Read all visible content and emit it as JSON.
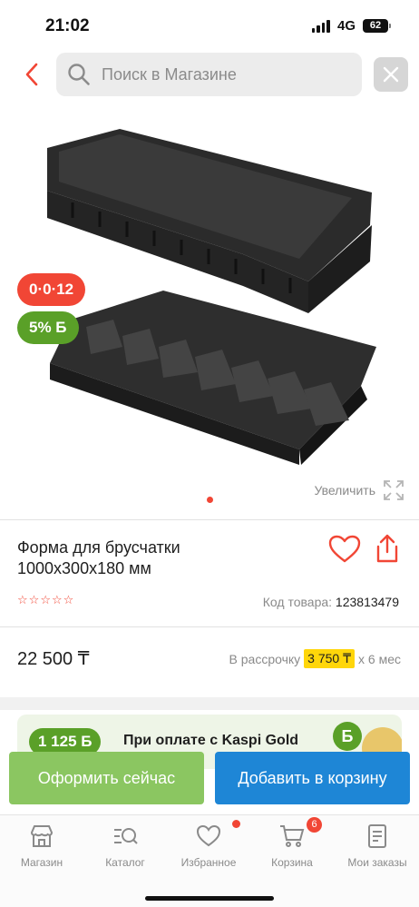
{
  "status_bar": {
    "time": "21:02",
    "network": "4G",
    "battery": "62"
  },
  "header": {
    "search_placeholder": "Поиск в Магазине"
  },
  "product": {
    "badge_installment": "0·0·12",
    "badge_bonus": "5% Б",
    "zoom_label": "Увеличить",
    "title_line1": "Форма для брусчатки",
    "title_line2": "1000х300х180 мм",
    "rating_stars": [
      "☆",
      "☆",
      "☆",
      "☆",
      "☆"
    ],
    "code_label": "Код товара:",
    "code_value": "123813479",
    "price": "22 500 ₸",
    "installment_prefix": "В рассрочку",
    "installment_amount": "3 750 ₸",
    "installment_suffix": "х 6 мес"
  },
  "promo": {
    "amount": "1 125 Б",
    "text": "При оплате с Kaspi Gold",
    "b_icon": "Б"
  },
  "actions": {
    "buy_now": "Оформить сейчас",
    "add_to_cart": "Добавить в корзину"
  },
  "bottom_nav": {
    "items": [
      {
        "label": "Магазин",
        "icon": "store-icon"
      },
      {
        "label": "Каталог",
        "icon": "catalog-search-icon"
      },
      {
        "label": "Избранное",
        "icon": "heart-icon"
      },
      {
        "label": "Корзина",
        "icon": "cart-icon"
      },
      {
        "label": "Мои заказы",
        "icon": "orders-icon"
      }
    ],
    "cart_count": "6"
  },
  "colors": {
    "accent_red": "#f14635",
    "bonus_green": "#5aa028",
    "buy_green": "#8bc661",
    "cart_blue": "#1e86d6",
    "installment_yellow": "#ffd60a"
  }
}
